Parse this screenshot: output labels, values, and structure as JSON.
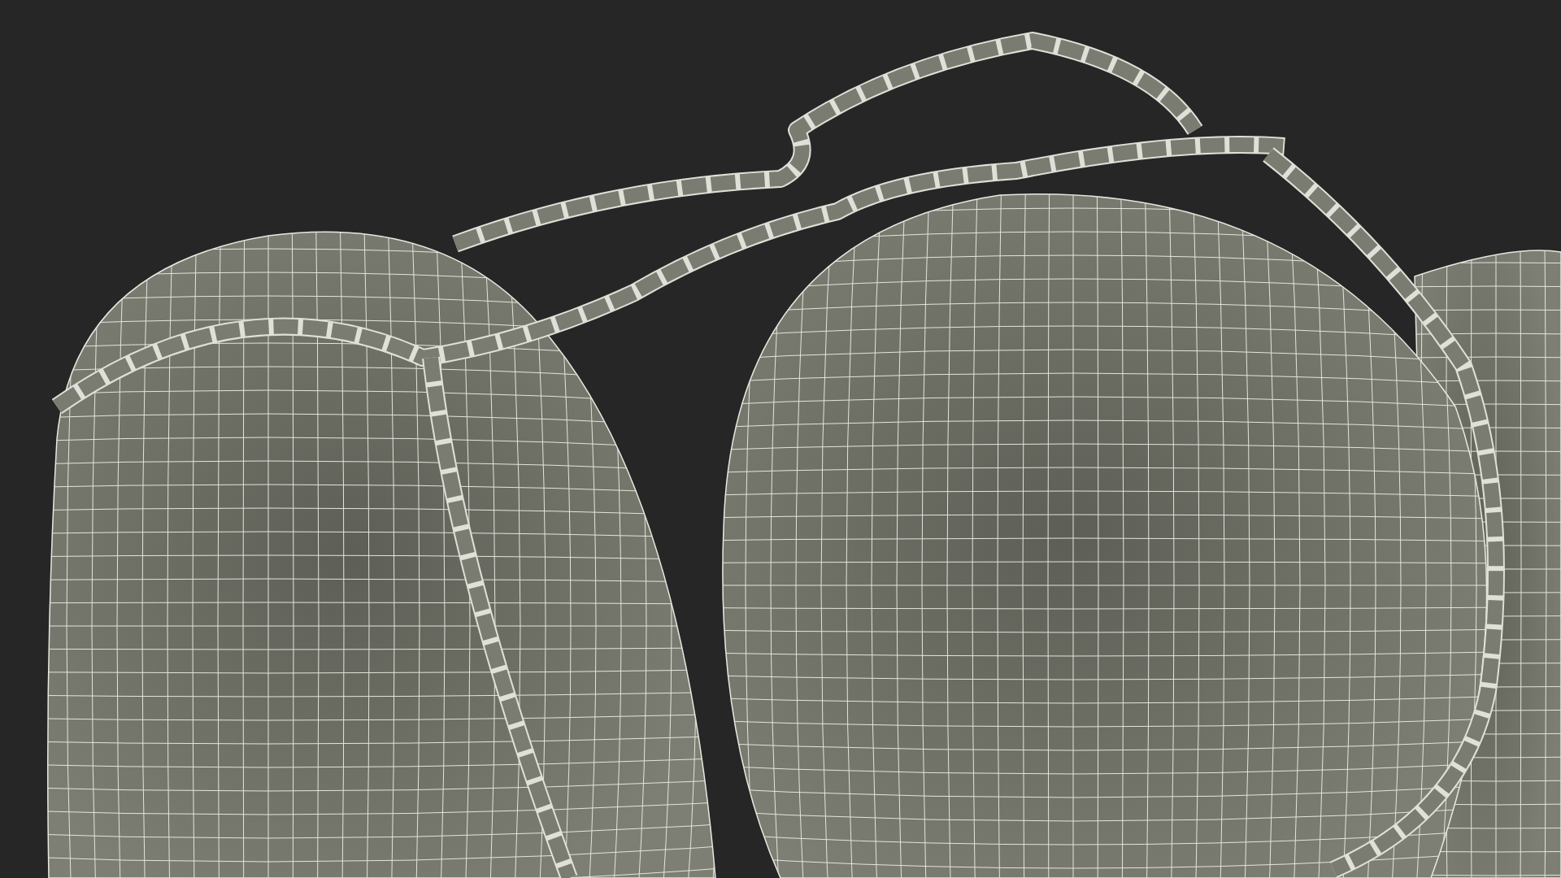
{
  "scene": {
    "kind": "wireframe"
  }
}
